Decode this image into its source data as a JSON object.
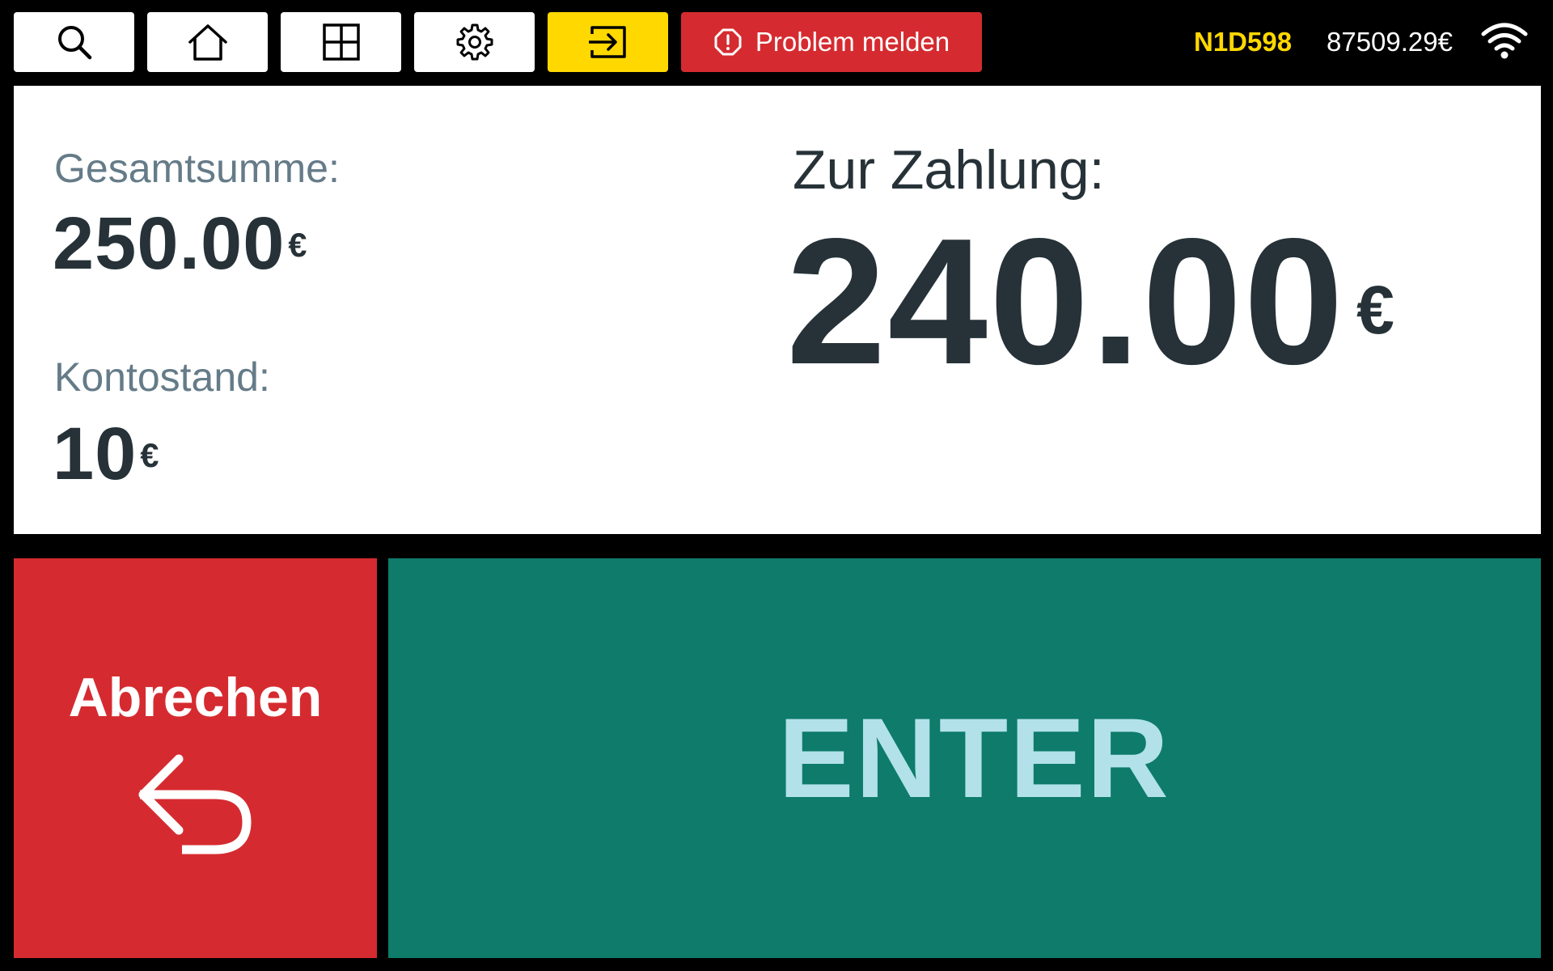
{
  "toolbar": {
    "buttons": [
      {
        "name": "search",
        "icon": "search-icon"
      },
      {
        "name": "home",
        "icon": "home-icon"
      },
      {
        "name": "grid",
        "icon": "grid-icon"
      },
      {
        "name": "settings",
        "icon": "gear-icon"
      },
      {
        "name": "login",
        "icon": "login-icon"
      }
    ],
    "problem_label": "Problem melden",
    "problem_icon": "alert-octagon-icon"
  },
  "status": {
    "terminal_id": "N1D598",
    "balance": "87509.29€",
    "wifi_icon": "wifi-icon"
  },
  "summary": {
    "total_label": "Gesamtsumme:",
    "total_value": "250.00",
    "total_currency": "€",
    "balance_label": "Kontostand:",
    "balance_value": "10",
    "balance_currency": "€",
    "pay_label": "Zur Zahlung:",
    "pay_value": "240.00",
    "pay_currency": "€"
  },
  "actions": {
    "cancel_label": "Abrechen",
    "cancel_icon": "undo-arrow-icon",
    "enter_label": "ENTER"
  },
  "colors": {
    "accent_yellow": "#ffd800",
    "danger_red": "#d52b30",
    "enter_green": "#0e7b6b",
    "enter_text": "#b2e1ea",
    "text_dark": "#263238",
    "text_muted": "#657b88"
  }
}
